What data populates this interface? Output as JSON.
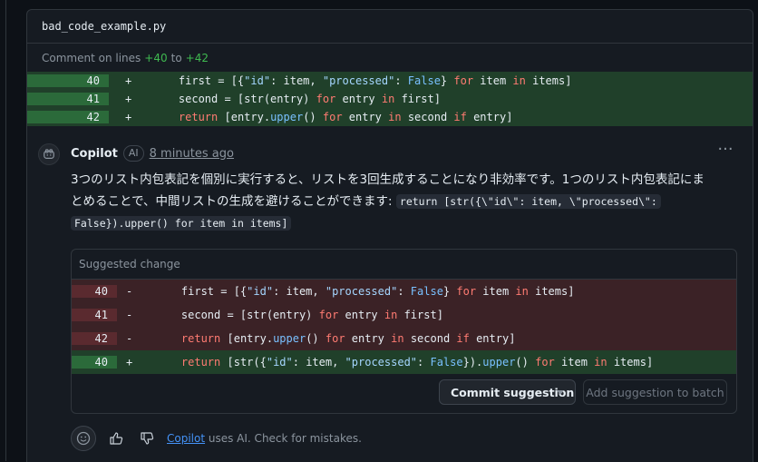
{
  "file": {
    "name": "bad_code_example.py"
  },
  "comment_on": {
    "prefix": "Comment on lines",
    "start": "+40",
    "sep": "to",
    "end": "+42"
  },
  "context_lines": [
    {
      "num": "40",
      "sign": "+",
      "tokens": [
        [
          "id",
          "    first = [{"
        ],
        [
          "str",
          "\"id\""
        ],
        [
          "id",
          ": item, "
        ],
        [
          "str",
          "\"processed\""
        ],
        [
          "id",
          ": "
        ],
        [
          "bool",
          "False"
        ],
        [
          "id",
          "} "
        ],
        [
          "kw",
          "for"
        ],
        [
          "id",
          " item "
        ],
        [
          "kw",
          "in"
        ],
        [
          "id",
          " items]"
        ]
      ]
    },
    {
      "num": "41",
      "sign": "+",
      "tokens": [
        [
          "id",
          "    second = [str(entry) "
        ],
        [
          "kw",
          "for"
        ],
        [
          "id",
          " entry "
        ],
        [
          "kw",
          "in"
        ],
        [
          "id",
          " first]"
        ]
      ]
    },
    {
      "num": "42",
      "sign": "+",
      "tokens": [
        [
          "id",
          "    "
        ],
        [
          "kw",
          "return"
        ],
        [
          "id",
          " [entry."
        ],
        [
          "fn",
          "upper"
        ],
        [
          "id",
          "() "
        ],
        [
          "kw",
          "for"
        ],
        [
          "id",
          " entry "
        ],
        [
          "kw",
          "in"
        ],
        [
          "id",
          " second "
        ],
        [
          "kw",
          "if"
        ],
        [
          "id",
          " entry]"
        ]
      ]
    }
  ],
  "comment": {
    "author": "Copilot",
    "badge": "AI",
    "time": "8 minutes ago",
    "body_line1": "3つのリスト内包表記を個別に実行すると、リストを3回生成することになり非効率です。1つのリスト内包表記にま",
    "body_line2": "とめることで、中間リストの生成を避けることができます: ",
    "code_part1": "return [str({\\\"id\\\": item, \\\"processed\\\":",
    "code_part2": "False}).upper() for item in items]"
  },
  "suggestion": {
    "title": "Suggested change",
    "lines": [
      {
        "type": "del",
        "num": "40",
        "sign": "-",
        "tokens": [
          [
            "id",
            "    first = [{"
          ],
          [
            "str",
            "\"id\""
          ],
          [
            "id",
            ": item, "
          ],
          [
            "str",
            "\"processed\""
          ],
          [
            "id",
            ": "
          ],
          [
            "bool",
            "False"
          ],
          [
            "id",
            "} "
          ],
          [
            "kw",
            "for"
          ],
          [
            "id",
            " item "
          ],
          [
            "kw",
            "in"
          ],
          [
            "id",
            " items]"
          ]
        ]
      },
      {
        "type": "del",
        "num": "41",
        "sign": "-",
        "tokens": [
          [
            "id",
            "    second = [str(entry) "
          ],
          [
            "kw",
            "for"
          ],
          [
            "id",
            " entry "
          ],
          [
            "kw",
            "in"
          ],
          [
            "id",
            " first]"
          ]
        ]
      },
      {
        "type": "del",
        "num": "42",
        "sign": "-",
        "tokens": [
          [
            "id",
            "    "
          ],
          [
            "kw",
            "return"
          ],
          [
            "id",
            " [entry."
          ],
          [
            "fn",
            "upper"
          ],
          [
            "id",
            "() "
          ],
          [
            "kw",
            "for"
          ],
          [
            "id",
            " entry "
          ],
          [
            "kw",
            "in"
          ],
          [
            "id",
            " second "
          ],
          [
            "kw",
            "if"
          ],
          [
            "id",
            " entry]"
          ]
        ]
      },
      {
        "type": "add",
        "num": "40",
        "sign": "+",
        "tokens": [
          [
            "id",
            "    "
          ],
          [
            "kw",
            "return"
          ],
          [
            "id",
            " [str({"
          ],
          [
            "str",
            "\"id\""
          ],
          [
            "id",
            ": item, "
          ],
          [
            "str",
            "\"processed\""
          ],
          [
            "id",
            ": "
          ],
          [
            "bool",
            "False"
          ],
          [
            "id",
            "})."
          ],
          [
            "fn",
            "upper"
          ],
          [
            "id",
            "() "
          ],
          [
            "kw",
            "for"
          ],
          [
            "id",
            " item "
          ],
          [
            "kw",
            "in"
          ],
          [
            "id",
            " items]"
          ]
        ]
      }
    ],
    "commit_label": "Commit suggestion",
    "batch_label": "Add suggestion to batch"
  },
  "footer": {
    "link": "Copilot",
    "text": " uses AI. Check for mistakes."
  },
  "icons": {
    "avatar": "copilot-icon",
    "react": "smiley-icon",
    "up": "thumbs-up-icon",
    "down": "thumbs-down-icon",
    "more": "kebab-horizontal-icon"
  }
}
